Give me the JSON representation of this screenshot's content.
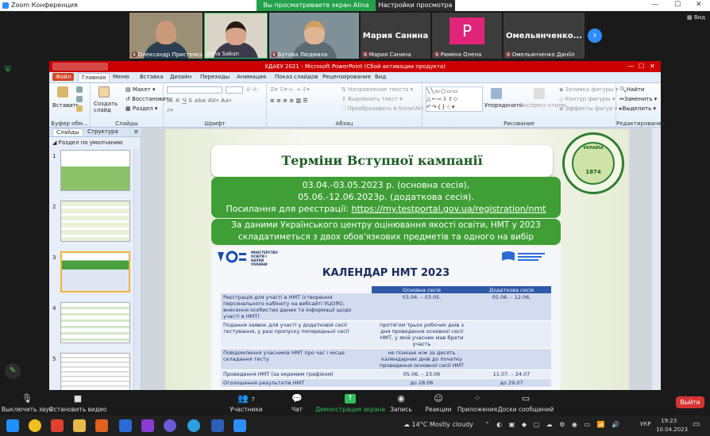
{
  "zoom": {
    "title": "Zoom Конференция",
    "sharing_banner": "Вы просматриваете экран Alina Sakun",
    "view_options": "Настройки просмотра",
    "video_label": "Вид",
    "participants": [
      {
        "name": "Олександр Пристемський",
        "muted": true
      },
      {
        "name": "Alina Sakun",
        "muted": false
      },
      {
        "name": "Бутова Людмила",
        "muted": true
      },
      {
        "name": "Мария Санина",
        "display": "Мария Санина",
        "muted": true
      },
      {
        "name": "Рюміна Олена",
        "display": "P",
        "muted": true
      },
      {
        "name": "Омельянченко Даніїл",
        "display": "Омельянченко...",
        "muted": true
      }
    ],
    "controls": [
      {
        "label": "Выключить звук",
        "icon": "microphone-icon",
        "glyph": "🎙"
      },
      {
        "label": "Остановить видео",
        "icon": "camera-icon",
        "glyph": "■"
      },
      {
        "label": "Участники",
        "icon": "participants-icon",
        "glyph": "👥",
        "count": "7"
      },
      {
        "label": "Чат",
        "icon": "chat-icon",
        "glyph": "💬"
      },
      {
        "label": "Демонстрация экрана",
        "icon": "share-screen-icon",
        "glyph": "↑"
      },
      {
        "label": "Запись",
        "icon": "record-icon",
        "glyph": "◉"
      },
      {
        "label": "Реакции",
        "icon": "reaction-icon",
        "glyph": "☺"
      },
      {
        "label": "Приложения",
        "icon": "apps-icon",
        "glyph": "⁘"
      },
      {
        "label": "Доски сообщений",
        "icon": "whiteboard-icon",
        "glyph": "▭"
      }
    ],
    "leave": "Выйти"
  },
  "ppt": {
    "window_title": "ХДАЕУ 2021 - Microsoft PowerPoint (Сбой активации продукта)",
    "tabs": [
      "Файл",
      "Главная",
      "Меню",
      "Вставка",
      "Дизайн",
      "Переходы",
      "Анимация",
      "Показ слайдов",
      "Рецензирование",
      "Вид"
    ],
    "active_tab": "Главная",
    "ribbon": {
      "paste": "Вставить",
      "create_slide": "Создать слайд",
      "layout": "Макет",
      "reset": "Восстановить",
      "section": "Раздел",
      "clipboard": "Буфер обм...",
      "slides": "Слайды",
      "font": "Шрифт",
      "paragraph": "Абзац",
      "text_direction": "Направление текста",
      "align_text": "Выровнять текст",
      "smartart": "Преобразовать в SmartArt",
      "arrange": "Упорядочить",
      "quick_styles": "Экспресс-стили",
      "shape_fill": "Заливка фигуры",
      "shape_outline": "Контур фигуры",
      "shape_effects": "Эффекты фигур",
      "drawing": "Рисование",
      "find": "Найти",
      "replace": "Заменить",
      "select": "Выделить",
      "editing": "Редактирование"
    },
    "panel_tabs": [
      "Слайды",
      "Структура"
    ],
    "section_label": "Раздел по умолчанию",
    "slide_numbers": [
      "1",
      "2",
      "3",
      "4",
      "5"
    ],
    "selected_slide": "3"
  },
  "slide": {
    "title": "Терміни Вступної кампанії",
    "dates_line1": "03.04.-03.05.2023 р. (основна сесія),",
    "dates_line2": "05.06.-12.06.2023р. (додаткова сесія).",
    "link_prefix": "Посилання для реєстрації: ",
    "link": "https://my.testportal.gov.ua/registration/nmt",
    "info_line1": "За даними Українського центру оцінювання якості освіти, НМТ у 2023",
    "info_line2": "складатиметься з двох обов'язкових предметів та одного на вибір",
    "logo_text": "УКРАЇНА",
    "logo_year": "1874",
    "ministry": "МІНІСТЕРСТВО ОСВІТИ І НАУКИ УКРАЇНИ",
    "calendar_title": "КАЛЕНДАР НМТ 2023",
    "table_headers": [
      "",
      "Основна сесія",
      "Додаткова сесія"
    ],
    "table_rows": [
      [
        "Реєстрація для участі в НМТ (створення персонального кабінету на вебсайті УЦОЯО, внесення особистих даних та інформації щодо участі в НМТ)",
        "03.04. – 03.05.",
        "05.06. – 12.06."
      ],
      [
        "Подання заявок для участі у додатковій сесії тестування, у разі пропуску попередньої сесії",
        "протягом трьох робочих днів з дня проведення основної сесії НМТ, у якій учасник мав брати участь",
        ""
      ],
      [
        "Повідомлення учасників НМТ про час і місце складання тесту",
        "не пізніше ніж за десять календарних днів до початку проведення основної сесії НМТ",
        ""
      ],
      [
        "Проведення НМТ (за окремим графіком)",
        "05.06. – 23.06",
        "11.07. – 24.07"
      ],
      [
        "Оголошення результатів НМТ",
        "до 28.06",
        "до 29.07"
      ]
    ]
  },
  "taskbar": {
    "weather": "14°C  Mostly cloudy",
    "lang": "УКР",
    "time": "19:23",
    "date": "10.04.2023"
  },
  "colors": {
    "zoom_blue": "#2d8cff",
    "share_green": "#22a04a",
    "ppt_red": "#cc0000",
    "slide_green": "#3f9f36",
    "leave_red": "#d53333"
  }
}
